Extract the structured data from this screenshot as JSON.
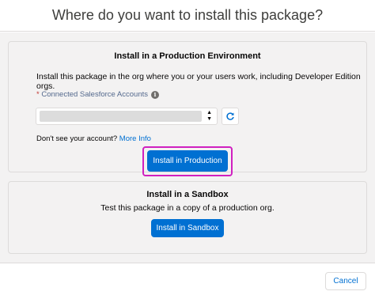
{
  "header": {
    "title": "Where do you want to install this package?"
  },
  "production": {
    "title": "Install in a Production Environment",
    "description": "Install this package in the org where you or your users work, including Developer Edition orgs.",
    "field_required_marker": "*",
    "field_label": "Connected Salesforce Accounts",
    "info_icon_glyph": "i",
    "select_caret": "▲▼",
    "hint_text": "Don't see your account?",
    "hint_link": "More Info",
    "button_label": "Install in Production"
  },
  "sandbox": {
    "title": "Install in a Sandbox",
    "description": "Test this package in a copy of a production org.",
    "button_label": "Install in Sandbox"
  },
  "footer": {
    "cancel_label": "Cancel"
  },
  "icons": {
    "info": "info-icon",
    "refresh": "refresh-icon",
    "caret": "select-caret-icon"
  },
  "colors": {
    "brand": "#0070d2",
    "highlight": "#d020c0",
    "required": "#c23934"
  }
}
